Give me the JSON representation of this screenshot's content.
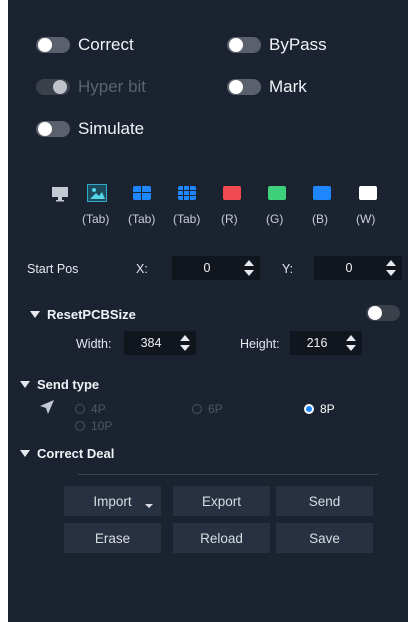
{
  "toggles": {
    "correct": "Correct",
    "bypass": "ByPass",
    "hyper_bit": "Hyper bit",
    "mark": "Mark",
    "simulate": "Simulate"
  },
  "patterns": [
    {
      "icon": "monitor-icon",
      "label": ""
    },
    {
      "icon": "image-icon",
      "label": "(Tab)"
    },
    {
      "icon": "grid-2x2-icon",
      "label": "(Tab)"
    },
    {
      "icon": "grid-3x3-icon",
      "label": "(Tab)"
    },
    {
      "icon": "red-swatch",
      "label": "(R)",
      "color": "#ef4a52"
    },
    {
      "icon": "green-swatch",
      "label": "(G)",
      "color": "#3fd07b"
    },
    {
      "icon": "blue-swatch",
      "label": "(B)",
      "color": "#1e86ff"
    },
    {
      "icon": "white-swatch",
      "label": "(W)",
      "color": "#ffffff"
    }
  ],
  "start_pos": {
    "label": "Start Pos",
    "x_label": "X:",
    "x_value": "0",
    "y_label": "Y:",
    "y_value": "0"
  },
  "reset_pcb": {
    "title": "ResetPCBSize",
    "width_label": "Width:",
    "width_value": "384",
    "height_label": "Height:",
    "height_value": "216"
  },
  "send_type": {
    "title": "Send type",
    "options": [
      "4P",
      "6P",
      "8P",
      "10P"
    ],
    "selected": "8P"
  },
  "correct_deal": {
    "title": "Correct Deal",
    "buttons": [
      "Import",
      "Export",
      "Send",
      "Erase",
      "Reload",
      "Save"
    ]
  },
  "colors": {
    "panel_bg": "#1b2230",
    "accent": "#1e86ff"
  }
}
